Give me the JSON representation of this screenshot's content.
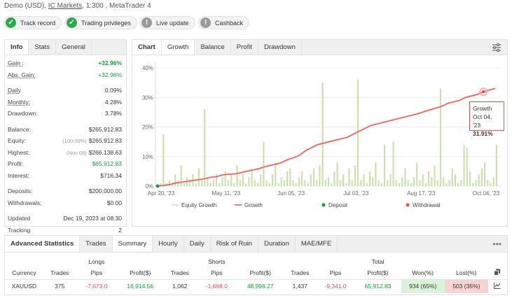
{
  "header": {
    "account": "Demo (USD),",
    "broker": "IC Markets",
    "rest": ", 1:300 , MetaTrader 4"
  },
  "badges": [
    {
      "label": "Track record",
      "state": "ok",
      "icon": "check-icon"
    },
    {
      "label": "Trading privileges",
      "state": "ok",
      "icon": "check-icon"
    },
    {
      "label": "Live update",
      "state": "warn",
      "icon": "exclamation-icon"
    },
    {
      "label": "Cashback",
      "state": "warn",
      "icon": "exclamation-icon"
    }
  ],
  "left": {
    "tabs": [
      "Info",
      "Stats",
      "General"
    ],
    "gain_label": "Gain :",
    "gain": "+32.96%",
    "abs_gain_label": "Abs. Gain:",
    "abs_gain": "+32.96%",
    "daily_label": "Daily",
    "daily": "0.09%",
    "monthly_label": "Monthly:",
    "monthly": "4.28%",
    "drawdown_label": "Drawdown:",
    "drawdown": "3.78%",
    "balance_label": "Balance:",
    "balance": "$265,912.83",
    "equity_label": "Equity:",
    "equity_sub": "(100.00%)",
    "equity": "$265,912.83",
    "highest_label": "Highest:",
    "highest_sub": "(Nov 09)",
    "highest": "$266,138.63",
    "profit_label": "Profit:",
    "profit": "$65,912.83",
    "interest_label": "Interest:",
    "interest": "$716.34",
    "deposits_label": "Deposits:",
    "deposits": "$200,000.00",
    "withdrawals_label": "Withdrawals:",
    "withdrawals": "$0.00",
    "updated_label": "Updated",
    "updated": "Dec 19, 2023 at 08:30",
    "tracking_label": "Tracking",
    "tracking": "2"
  },
  "chart_panel": {
    "tabs": [
      "Chart",
      "Growth",
      "Balance",
      "Profit",
      "Drawdown"
    ],
    "tooltip": {
      "title": "Growth",
      "date": "Oct 04, '23",
      "value": "31.91%"
    },
    "legend": [
      "Equity Growth",
      "Growth",
      "Deposit",
      "Withdrawal"
    ]
  },
  "chart_data": {
    "type": "line",
    "x_ticks": [
      "Apr 20, '23",
      "May 11, '23",
      "Jun 05, '23",
      "Jul 03, '23",
      "Aug 17, '23",
      "Oct 04, '23"
    ],
    "y_ticks": [
      "0%",
      "10%",
      "20%",
      "30%",
      "40%"
    ],
    "ylim": [
      0,
      40
    ],
    "grid": true,
    "series": [
      {
        "name": "Growth",
        "color": "#d9534f",
        "values": [
          0,
          0.2,
          0.5,
          1,
          1.3,
          1.6,
          1.9,
          2.2,
          2.5,
          3,
          3.2,
          3.8,
          4,
          4.1,
          4.5,
          5,
          5.4,
          5.8,
          6.5,
          7,
          7.4,
          8,
          9,
          9.6,
          10.5,
          12,
          13,
          14,
          14.5,
          15,
          15.5,
          16,
          16.5,
          17.5,
          18.5,
          19.5,
          20.5,
          21,
          21.5,
          22,
          22.5,
          23,
          23.5,
          24,
          24.5,
          25.2,
          25.8,
          26.4,
          27,
          28,
          28.5,
          29,
          30,
          30.5,
          31,
          31.9,
          32.5,
          33
        ]
      },
      {
        "name": "Equity Growth",
        "color": "#c5dea0",
        "values": [
          0,
          0.2,
          0.5,
          1,
          1.3,
          1.6,
          1.9,
          2.2,
          2.5,
          3,
          3.2,
          3.8,
          4,
          4.1,
          4.5,
          5,
          5.4,
          5.8,
          6.5,
          7,
          7.4,
          8,
          9,
          9.6,
          10.5,
          12,
          13,
          14,
          14.5,
          15,
          15.5,
          16,
          16.5,
          17.5,
          18.5,
          19.5,
          20.5,
          21,
          21.5,
          22,
          22.5,
          23,
          23.5,
          24,
          24.5,
          25.2,
          25.8,
          26.4,
          27,
          28,
          28.5,
          29,
          30,
          30.5,
          31,
          31.9,
          32.5,
          33
        ]
      }
    ],
    "bars": [
      1,
      17.5,
      1,
      2,
      1,
      4,
      2,
      7,
      1,
      3,
      2,
      4,
      1,
      6,
      2,
      26,
      3,
      1,
      2,
      4,
      1,
      3,
      5,
      2,
      4,
      1,
      7,
      2,
      4,
      1,
      3,
      6,
      2,
      1,
      4,
      15,
      2,
      1,
      4,
      8,
      1,
      3,
      2,
      5,
      6,
      2,
      1,
      3,
      5,
      2,
      1,
      4,
      6,
      2,
      7,
      35,
      2,
      3,
      1,
      5,
      8,
      2,
      4,
      1,
      6,
      2,
      7,
      36,
      2,
      4,
      1,
      5,
      3,
      8,
      2,
      1,
      14,
      2,
      4,
      15,
      2,
      1,
      3,
      6,
      2,
      1,
      3,
      8,
      2,
      4,
      1,
      5,
      3,
      7,
      2,
      33,
      3,
      1,
      2,
      6,
      4,
      1,
      2,
      14,
      13,
      5,
      1,
      2,
      4,
      6,
      8,
      2,
      1,
      3,
      14
    ]
  },
  "advanced": {
    "tabs": [
      "Advanced Statistics",
      "Trades",
      "Summary",
      "Hourly",
      "Daily",
      "Risk of Ruin",
      "Duration",
      "MAE/MFE"
    ],
    "groups": [
      "Longs",
      "Shorts",
      "Total"
    ],
    "columns": [
      "Currency",
      "Trades",
      "Pips",
      "Profit($)",
      "Trades",
      "Pips",
      "Profit($)",
      "Trades",
      "Pips",
      "Profit($)",
      "Won(%)",
      "Lost(%)"
    ],
    "row": [
      "XAUUSD",
      "375",
      "-7,673.0",
      "16,914.56",
      "1,062",
      "-1,668.0",
      "48,998.27",
      "1,437",
      "-9,341.0",
      "65,912.83",
      "934 (65%)",
      "503 (35%)"
    ]
  }
}
